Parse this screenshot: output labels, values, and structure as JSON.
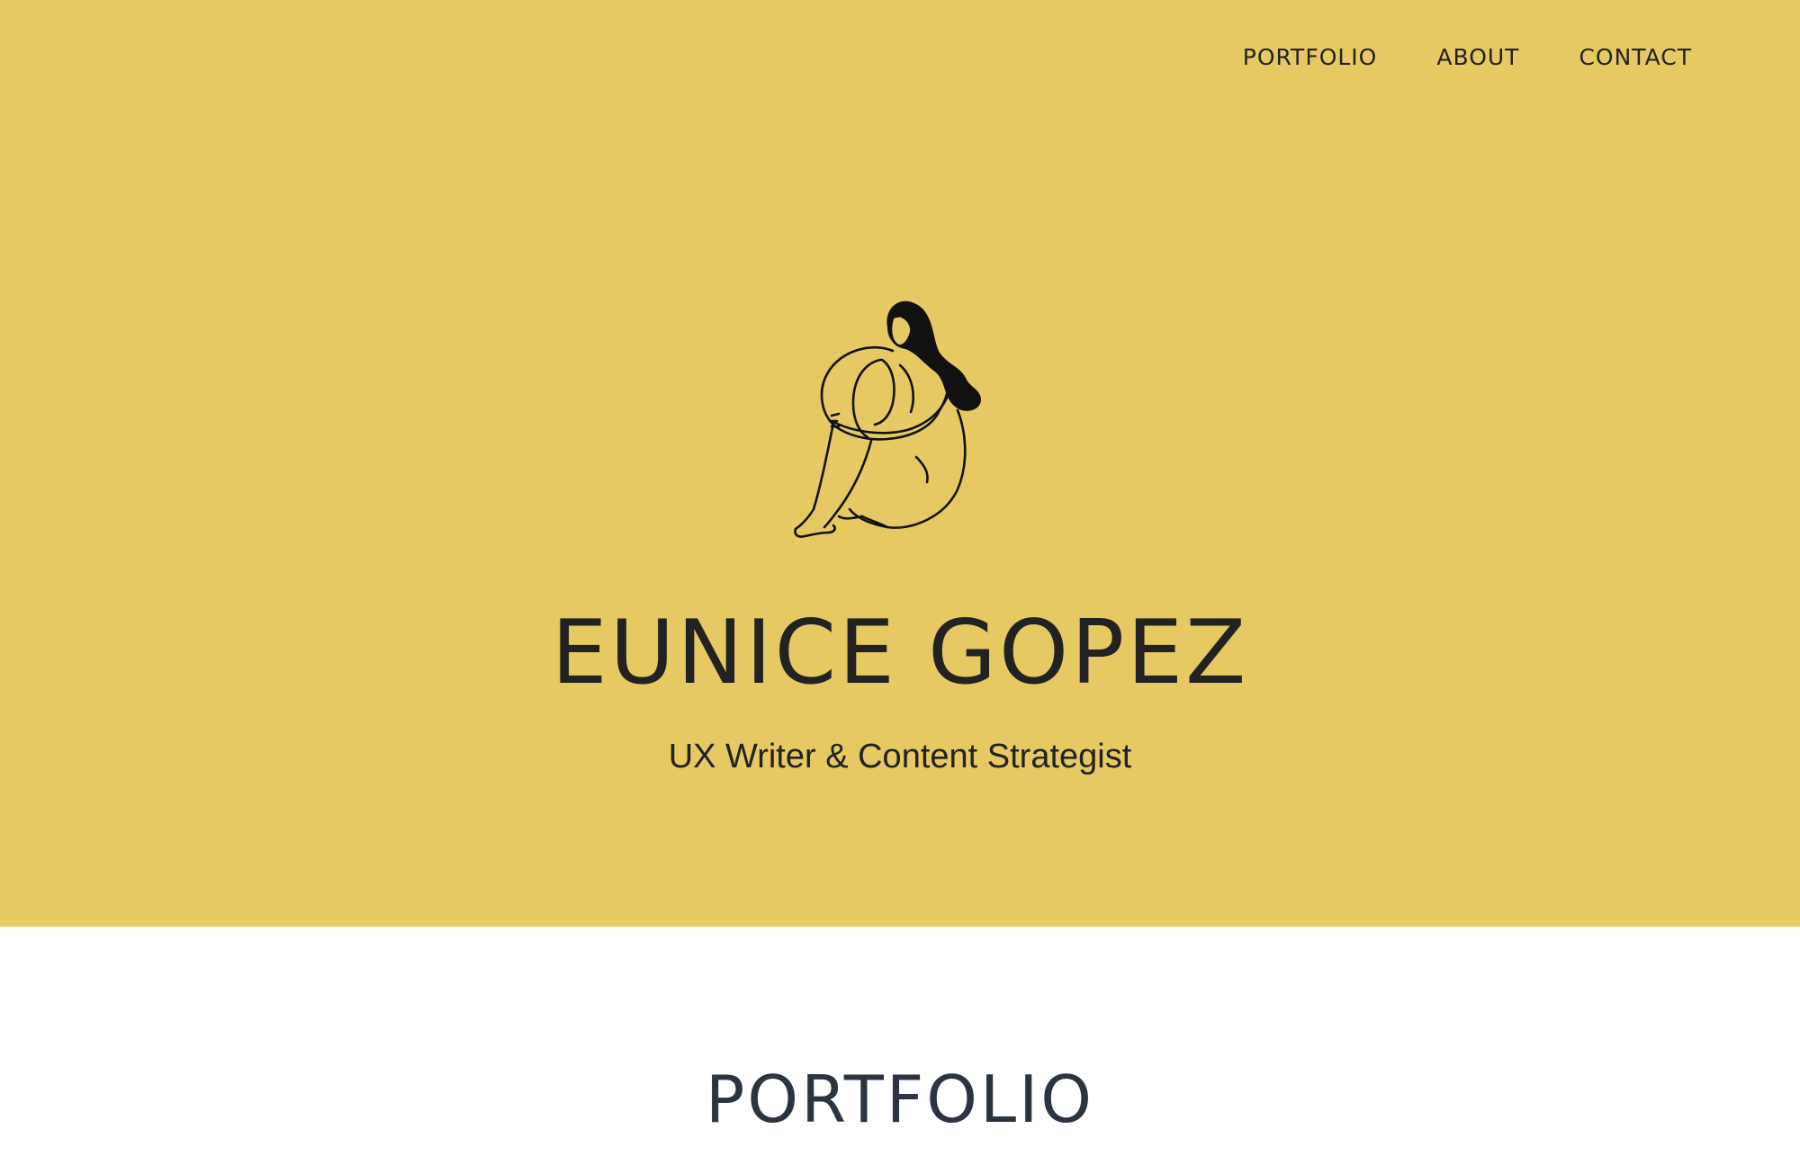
{
  "nav": {
    "items": [
      {
        "label": "PORTFOLIO"
      },
      {
        "label": "ABOUT"
      },
      {
        "label": "CONTACT"
      }
    ]
  },
  "hero": {
    "name": "EUNICE GOPEZ",
    "tagline": "UX Writer & Content Strategist",
    "illustration": "sitting-woman-line-drawing",
    "background_color": "#e6c962"
  },
  "portfolio": {
    "title": "PORTFOLIO"
  },
  "colors": {
    "text": "#222222",
    "section_title": "#2b3440",
    "page_background": "#ffffff"
  }
}
